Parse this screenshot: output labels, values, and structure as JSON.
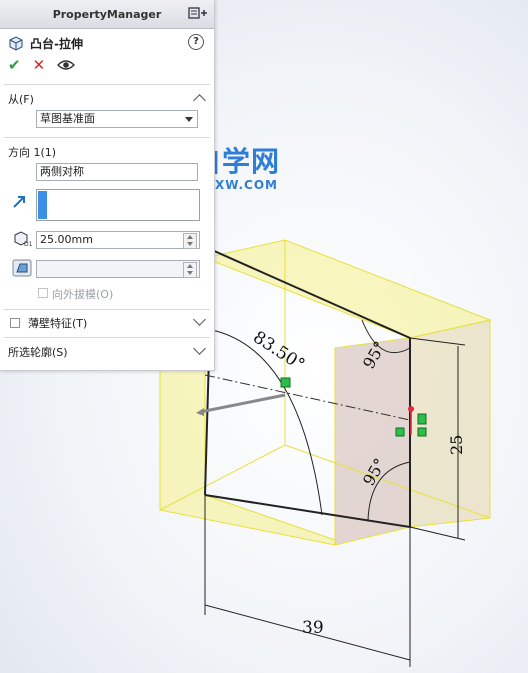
{
  "panel": {
    "header_title": "PropertyManager",
    "feature_name": "凸台-拉伸",
    "help_label": "?",
    "actions": {
      "ok": "✔",
      "cancel": "✕"
    },
    "from_section": {
      "title": "从(F)",
      "value": "草图基准面"
    },
    "direction_section": {
      "title": "方向 1(1)",
      "end_condition": "两侧对称",
      "depth_value": "25.00mm",
      "draft_value": "",
      "draft_outward_label": "向外拔模(O)"
    },
    "thin_feature": {
      "title": "薄壁特征(T)"
    },
    "selected_contours": {
      "title": "所选轮廓(S)"
    }
  },
  "watermark": {
    "line1": "软件自学网",
    "line2": "WWW.RUZXW.COM"
  },
  "dimensions": {
    "angle_top": "83.50°",
    "angle_right_top": "95°",
    "angle_right_bottom": "95°",
    "height": "25",
    "width": "39"
  },
  "colors": {
    "accent_blue": "#3d8fe6",
    "extrude_yellow": "#f5f08a",
    "ok_green": "#2e9e3a",
    "cancel_red": "#d22b2b"
  }
}
